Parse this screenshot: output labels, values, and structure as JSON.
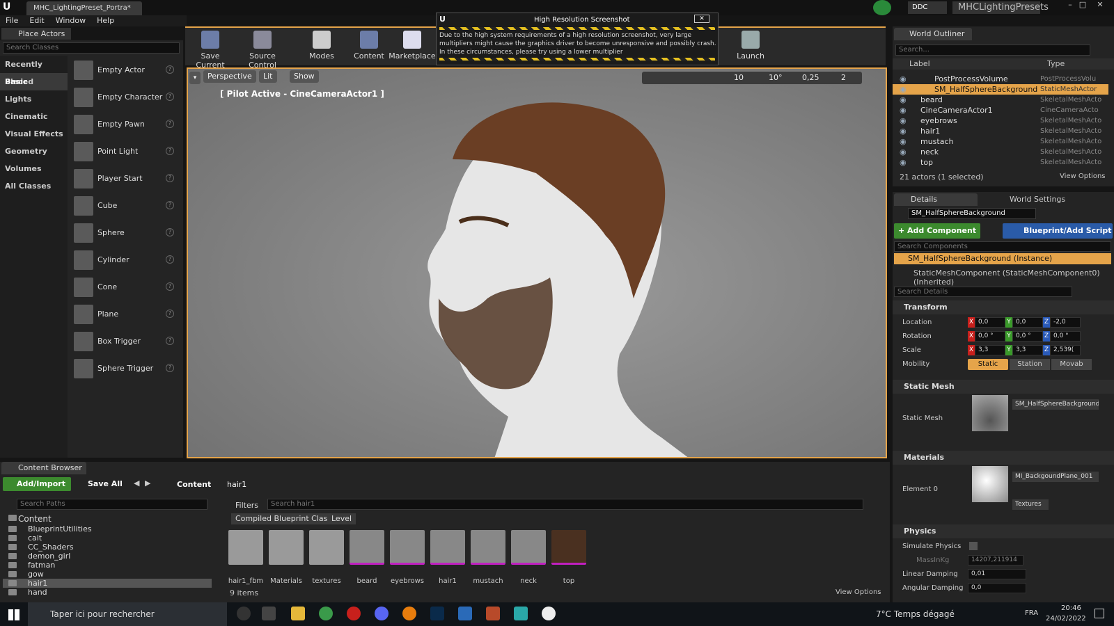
{
  "window": {
    "tab_title": "MHC_LightingPreset_Portra*",
    "ddc": "DDC",
    "project": "MHCLightingPresets"
  },
  "menu": [
    "File",
    "Edit",
    "Window",
    "Help"
  ],
  "place_actors": {
    "title": "Place Actors",
    "search_placeholder": "Search Classes",
    "categories": [
      "Recently Placed",
      "Basic",
      "Lights",
      "Cinematic",
      "Visual Effects",
      "Geometry",
      "Volumes",
      "All Classes"
    ],
    "items": [
      "Empty Actor",
      "Empty Character",
      "Empty Pawn",
      "Point Light",
      "Player Start",
      "Cube",
      "Sphere",
      "Cylinder",
      "Cone",
      "Plane",
      "Box Trigger",
      "Sphere Trigger"
    ]
  },
  "toolbar": {
    "save": "Save Current",
    "source": "Source Control",
    "modes": "Modes",
    "content": "Content",
    "marketplace": "Marketplace",
    "launch": "Launch"
  },
  "dialog": {
    "title": "High Resolution Screenshot",
    "line1": "Due to the high system requirements of a high resolution screenshot, very large",
    "line2": "multipliers might cause the graphics driver to become unresponsive and possibly crash.",
    "line3": "In these circumstances, please try using a lower multiplier"
  },
  "viewport": {
    "perspective": "Perspective",
    "lit": "Lit",
    "show": "Show",
    "pilot": "[ Pilot Active - CineCameraActor1 ]",
    "grid": "10",
    "rot": "10°",
    "scale": "0,25",
    "cam": "2"
  },
  "outliner": {
    "title": "World Outliner",
    "search_placeholder": "Search...",
    "col_label": "Label",
    "col_type": "Type",
    "rows": [
      {
        "n": "PostProcessVolume",
        "t": "PostProcessVolu"
      },
      {
        "n": "SM_HalfSphereBackground",
        "t": "StaticMeshActor"
      },
      {
        "n": "beard",
        "t": "SkeletalMeshActo"
      },
      {
        "n": "CineCameraActor1",
        "t": "CineCameraActo"
      },
      {
        "n": "eyebrows",
        "t": "SkeletalMeshActo"
      },
      {
        "n": "hair1",
        "t": "SkeletalMeshActo"
      },
      {
        "n": "mustach",
        "t": "SkeletalMeshActo"
      },
      {
        "n": "neck",
        "t": "SkeletalMeshActo"
      },
      {
        "n": "top",
        "t": "SkeletalMeshActo"
      }
    ],
    "count": "21 actors (1 selected)",
    "view_options": "View Options"
  },
  "details": {
    "tab": "Details",
    "world_tab": "World Settings",
    "name": "SM_HalfSphereBackground",
    "add_component": "+ Add Component",
    "blueprint": "Blueprint/Add Script",
    "search_components": "Search Components",
    "instance": "SM_HalfSphereBackground (Instance)",
    "component": "StaticMeshComponent (StaticMeshComponent0) (Inherited)",
    "search_details": "Search Details",
    "transform": "Transform",
    "location": "Location",
    "rotation": "Rotation",
    "scale": "Scale",
    "mobility": "Mobility",
    "loc": [
      "0,0",
      "0,0",
      "-2,0"
    ],
    "rot": [
      "0,0 °",
      "0,0 °",
      "0,0 °"
    ],
    "scl": [
      "3,3",
      "3,3",
      "2,539("
    ],
    "mob": [
      "Static",
      "Station",
      "Movab"
    ],
    "static_mesh_sec": "Static Mesh",
    "static_mesh_label": "Static Mesh",
    "static_mesh_value": "SM_HalfSphereBackground",
    "materials_sec": "Materials",
    "element0": "Element 0",
    "material_value": "MI_BackgoundPlane_001",
    "textures": "Textures",
    "physics": "Physics",
    "simulate": "Simulate Physics",
    "mass": "MassInKg",
    "mass_value": "14207,211914",
    "lin_damp": "Linear Damping",
    "lin_value": "0,01",
    "ang_damp": "Angular Damping",
    "ang_value": "0,0"
  },
  "content_browser": {
    "title": "Content Browser",
    "add": "Add/Import",
    "save_all": "Save All",
    "path_content": "Content",
    "path_hair": "hair1",
    "search_paths": "Search Paths",
    "filters": "Filters",
    "search_assets": "Search hair1",
    "chip1": "Compiled Blueprint Class",
    "chip2": "Level",
    "tree": [
      "Content",
      "BlueprintUtilities",
      "cait",
      "CC_Shaders",
      "demon_girl",
      "fatman",
      "gow",
      "hair1",
      "hand"
    ],
    "assets": [
      "hair1_fbm",
      "Materials",
      "textures",
      "beard",
      "eyebrows",
      "hair1",
      "mustach",
      "neck",
      "top"
    ],
    "count": "9 items",
    "view_options": "View Options"
  },
  "taskbar": {
    "search": "Taper ici pour rechercher",
    "weather": "7°C  Temps dégagé",
    "lang": "FRA",
    "time": "20:46",
    "date": "24/02/2022"
  }
}
